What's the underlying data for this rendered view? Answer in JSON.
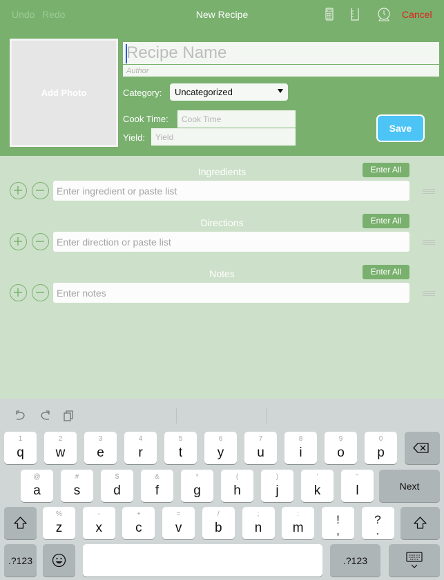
{
  "navbar": {
    "undo_label": "Undo",
    "redo_label": "Redo",
    "title": "New Recipe",
    "icons": [
      "calculator-icon",
      "measuring-cup-icon",
      "timer-icon"
    ],
    "cancel_label": "Cancel"
  },
  "form": {
    "add_photo_label": "Add Photo",
    "recipe_name_placeholder": "Recipe Name",
    "author_placeholder": "Author",
    "category_label": "Category:",
    "category_value": "Uncategorized",
    "cook_time_label": "Cook Time:",
    "cook_time_placeholder": "Cook Time",
    "yield_label": "Yield:",
    "yield_placeholder": "Yield",
    "save_label": "Save"
  },
  "sections": [
    {
      "title": "Ingredients",
      "enter_all_label": "Enter All",
      "placeholder": "Enter ingredient or paste list"
    },
    {
      "title": "Directions",
      "enter_all_label": "Enter All",
      "placeholder": "Enter direction or paste list"
    },
    {
      "title": "Notes",
      "enter_all_label": "Enter All",
      "placeholder": "Enter notes"
    }
  ],
  "keyboard": {
    "shortcuts": [
      "undo-icon",
      "redo-icon",
      "paste-icon"
    ],
    "row1": [
      {
        "hint": "1",
        "key": "q"
      },
      {
        "hint": "2",
        "key": "w"
      },
      {
        "hint": "3",
        "key": "e"
      },
      {
        "hint": "4",
        "key": "r"
      },
      {
        "hint": "5",
        "key": "t"
      },
      {
        "hint": "6",
        "key": "y"
      },
      {
        "hint": "7",
        "key": "u"
      },
      {
        "hint": "8",
        "key": "i"
      },
      {
        "hint": "9",
        "key": "o"
      },
      {
        "hint": "0",
        "key": "p"
      }
    ],
    "row2": [
      {
        "hint": "@",
        "key": "a"
      },
      {
        "hint": "#",
        "key": "s"
      },
      {
        "hint": "$",
        "key": "d"
      },
      {
        "hint": "&",
        "key": "f"
      },
      {
        "hint": "*",
        "key": "g"
      },
      {
        "hint": "(",
        "key": "h"
      },
      {
        "hint": ")",
        "key": "j"
      },
      {
        "hint": "’",
        "key": "k"
      },
      {
        "hint": "”",
        "key": "l"
      }
    ],
    "row3": [
      {
        "hint": "%",
        "key": "z"
      },
      {
        "hint": "-",
        "key": "x"
      },
      {
        "hint": "+",
        "key": "c"
      },
      {
        "hint": "=",
        "key": "v"
      },
      {
        "hint": "/",
        "key": "b"
      },
      {
        "hint": ";",
        "key": "n"
      },
      {
        "hint": ":",
        "key": "m"
      }
    ],
    "punct": [
      {
        "top": "!",
        "bottom": ","
      },
      {
        "top": "?",
        "bottom": "."
      }
    ],
    "next_label": "Next",
    "numbers_label": ".?123",
    "numbers_label_right": ".?123"
  }
}
